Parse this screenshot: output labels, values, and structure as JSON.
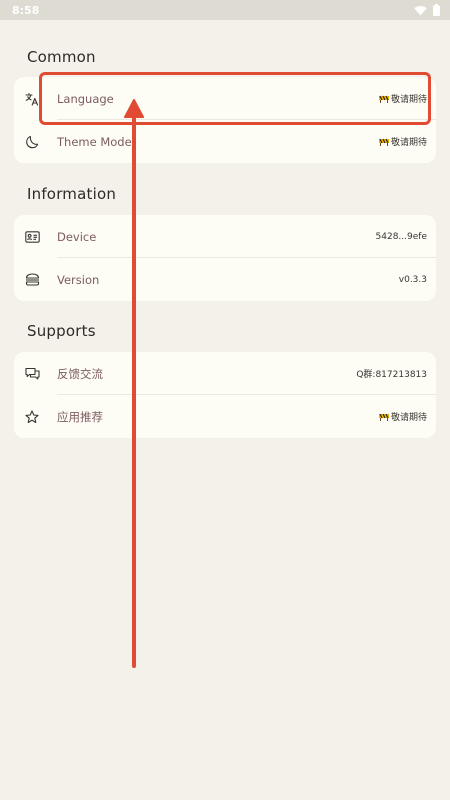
{
  "status_bar": {
    "time": "8:58",
    "icons": [
      "wifi-icon",
      "battery-icon"
    ]
  },
  "sections": {
    "common": {
      "title": "Common",
      "items": [
        {
          "icon": "translate-icon",
          "label": "Language",
          "value": "敬请期待",
          "value_icon": "construction-icon"
        },
        {
          "icon": "moon-icon",
          "label": "Theme Mode",
          "value": "敬请期待",
          "value_icon": "construction-icon"
        }
      ]
    },
    "information": {
      "title": "Information",
      "items": [
        {
          "icon": "id-card-icon",
          "label": "Device",
          "value": "5428...9efe"
        },
        {
          "icon": "layers-icon",
          "label": "Version",
          "value": "v0.3.3"
        }
      ]
    },
    "supports": {
      "title": "Supports",
      "items": [
        {
          "icon": "chat-icon",
          "label": "反馈交流",
          "value": "Q群:817213813"
        },
        {
          "icon": "star-icon",
          "label": "应用推荐",
          "value": "敬请期待",
          "value_icon": "construction-icon"
        }
      ]
    }
  },
  "annotation": {
    "color": "#e14a33",
    "target": "Language"
  },
  "colors": {
    "background": "#f3f1ea",
    "card": "#fdfcf5",
    "label": "#7d5c5f"
  }
}
